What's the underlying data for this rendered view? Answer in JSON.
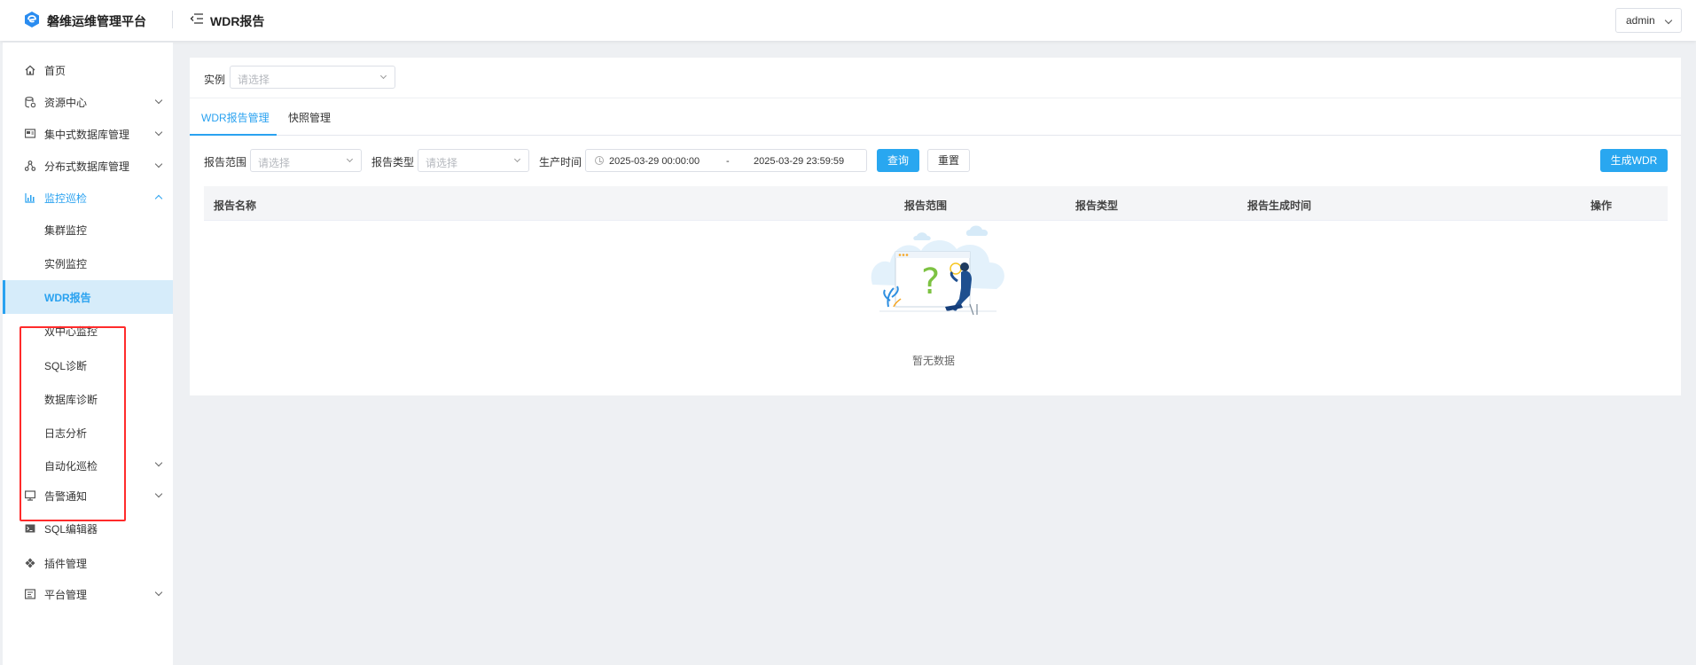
{
  "header": {
    "app_title": "磐维运维管理平台",
    "page_title": "WDR报告",
    "user": "admin"
  },
  "sidebar": {
    "items": [
      {
        "label": "首页",
        "icon": "home-icon"
      },
      {
        "label": "资源中心",
        "icon": "database-icon",
        "expandable": true
      },
      {
        "label": "集中式数据库管理",
        "icon": "server-icon",
        "expandable": true
      },
      {
        "label": "分布式数据库管理",
        "icon": "cluster-icon",
        "expandable": true
      },
      {
        "label": "监控巡检",
        "icon": "monitor-chart-icon",
        "expandable": true,
        "open": true
      },
      {
        "label": "告警通知",
        "icon": "screen-icon",
        "expandable": true
      },
      {
        "label": "SQL编辑器",
        "icon": "terminal-icon"
      },
      {
        "label": "插件管理",
        "icon": "plugin-icon"
      },
      {
        "label": "平台管理",
        "icon": "settings-panel-icon",
        "expandable": true
      }
    ],
    "monitor_children": [
      {
        "label": "集群监控"
      },
      {
        "label": "实例监控"
      },
      {
        "label": "WDR报告",
        "active": true
      },
      {
        "label": "双中心监控"
      },
      {
        "label": "SQL诊断"
      },
      {
        "label": "数据库诊断"
      },
      {
        "label": "日志分析"
      },
      {
        "label": "自动化巡检",
        "expandable": true
      }
    ]
  },
  "instance_filter": {
    "label": "实例",
    "placeholder": "请选择"
  },
  "tabs": [
    {
      "label": "WDR报告管理",
      "active": true
    },
    {
      "label": "快照管理"
    }
  ],
  "filters": {
    "range_label": "报告范围",
    "range_placeholder": "请选择",
    "type_label": "报告类型",
    "type_placeholder": "请选择",
    "time_label": "生产时间",
    "start_time": "2025-03-29 00:00:00",
    "separator": "-",
    "end_time": "2025-03-29 23:59:59",
    "query_button": "查询",
    "reset_button": "重置",
    "generate_button": "生成WDR"
  },
  "table": {
    "columns": [
      "报告名称",
      "报告范围",
      "报告类型",
      "报告生成时间",
      "操作"
    ],
    "rows": [],
    "empty_text": "暂无数据"
  },
  "colors": {
    "accent": "#29a7f0",
    "highlight_box": "#ff2b2b",
    "active_bg": "#d6ecfa"
  }
}
